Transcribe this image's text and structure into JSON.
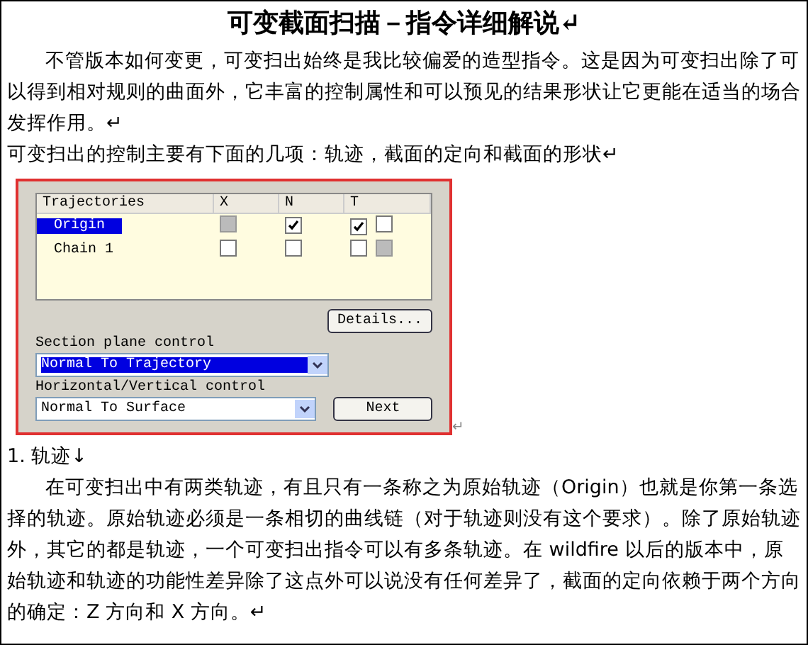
{
  "title": "可变截面扫描－指令详细解说↵",
  "intro": [
    "不管版本如何变更，可变扫出始终是我比较偏爱的造型指令。这是因为可变扫出除了可以得到相对规则的曲面外，它丰富的控制属性和可以预见的结果形状让它更能在适当的场合发挥作用。↵",
    "可变扫出的控制主要有下面的几项：轨迹，截面的定向和截面的形状↵"
  ],
  "dialog": {
    "columns": [
      "Trajectories",
      "X",
      "N",
      "T"
    ],
    "rows": [
      {
        "name": "Origin",
        "selected": true,
        "x": {
          "checked": false,
          "disabled": true
        },
        "n": {
          "checked": true,
          "disabled": false
        },
        "t": [
          {
            "checked": true,
            "disabled": false
          },
          {
            "checked": false,
            "disabled": false
          }
        ]
      },
      {
        "name": "Chain 1",
        "selected": false,
        "x": {
          "checked": false,
          "disabled": false
        },
        "n": {
          "checked": false,
          "disabled": false
        },
        "t": [
          {
            "checked": false,
            "disabled": false
          },
          {
            "checked": false,
            "disabled": true
          }
        ]
      }
    ],
    "details_button": "Details...",
    "section_label": "Section plane control",
    "section_value": "Normal To Trajectory",
    "hv_label": "Horizontal/Vertical control",
    "hv_value": "Normal To Surface",
    "next_button": "Next"
  },
  "after_figure": "↵",
  "heading": "1.  轨迹↓",
  "body": "在可变扫出中有两类轨迹，有且只有一条称之为原始轨迹（Origin）也就是你第一条选择的轨迹。原始轨迹必须是一条相切的曲线链（对于轨迹则没有这个要求）。除了原始轨迹外，其它的都是轨迹，一个可变扫出指令可以有多条轨迹。在 wildfire 以后的版本中，原始轨迹和轨迹的功能性差异除了这点外可以说没有任何差异了，截面的定向依赖于两个方向的确定：Z 方向和 X 方向。↵"
}
